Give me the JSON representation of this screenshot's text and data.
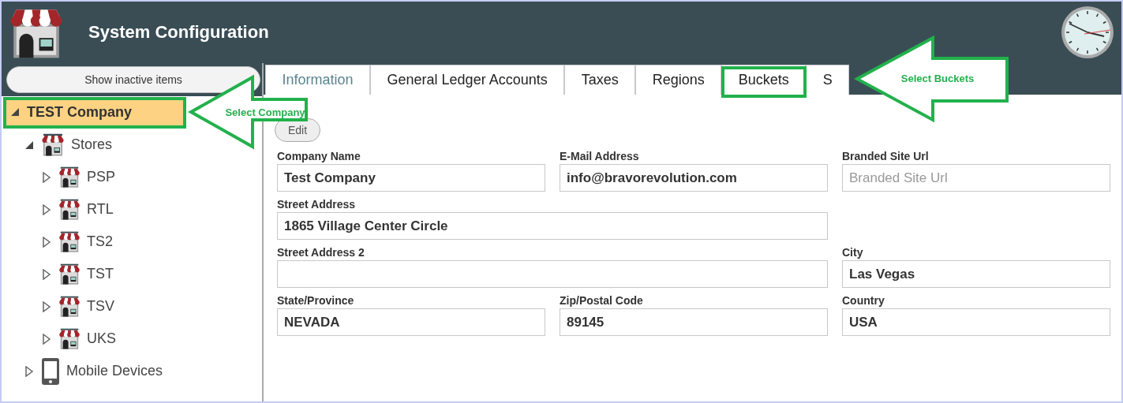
{
  "window": {
    "title": "System Configuration"
  },
  "sidebar": {
    "button": "Show inactive items",
    "tree": [
      {
        "label": "TEST Company",
        "expanded": true,
        "selected": true,
        "children": [
          {
            "label": "Stores",
            "kind": "stores",
            "expanded": true,
            "selected": false,
            "children": [
              {
                "label": "PSP",
                "kind": "store",
                "expanded": false,
                "selected": false
              },
              {
                "label": "RTL",
                "kind": "store",
                "expanded": false,
                "selected": false
              },
              {
                "label": "TS2",
                "kind": "store",
                "expanded": false,
                "selected": false
              },
              {
                "label": "TST",
                "kind": "store",
                "expanded": false,
                "selected": false
              },
              {
                "label": "TSV",
                "kind": "store",
                "expanded": false,
                "selected": false
              },
              {
                "label": "UKS",
                "kind": "store",
                "expanded": false,
                "selected": false
              }
            ]
          },
          {
            "label": "Mobile Devices",
            "kind": "phone",
            "expanded": false,
            "selected": false
          }
        ]
      }
    ]
  },
  "tabs": [
    {
      "label": "Information",
      "selected": true
    },
    {
      "label": "General Ledger Accounts",
      "selected": false
    },
    {
      "label": "Taxes",
      "selected": false
    },
    {
      "label": "Regions",
      "selected": false
    },
    {
      "label": "Buckets",
      "selected": false
    },
    {
      "label": "S",
      "selected": false
    }
  ],
  "edit_button": "Edit",
  "form": [
    [
      {
        "label": "Company Name",
        "value": "Test Company"
      },
      {
        "label": "E-Mail Address",
        "value": "info@bravorevolution.com"
      },
      {
        "label": "Branded Site Url",
        "placeholder": "Branded Site Url"
      }
    ],
    [
      {
        "label": "Street Address",
        "value": "1865 Village Center Circle",
        "wide": true
      }
    ],
    [
      {
        "label": "Street Address 2",
        "wide": true
      },
      {
        "label": "City",
        "value": "Las Vegas"
      }
    ],
    [
      {
        "label": "State/Province",
        "value": "NEVADA"
      },
      {
        "label": "Zip/Postal Code",
        "value": "89145"
      },
      {
        "label": "Country",
        "value": "USA"
      }
    ]
  ],
  "annotations": [
    {
      "text": "Select Company"
    },
    {
      "text": "Select Buckets"
    }
  ]
}
